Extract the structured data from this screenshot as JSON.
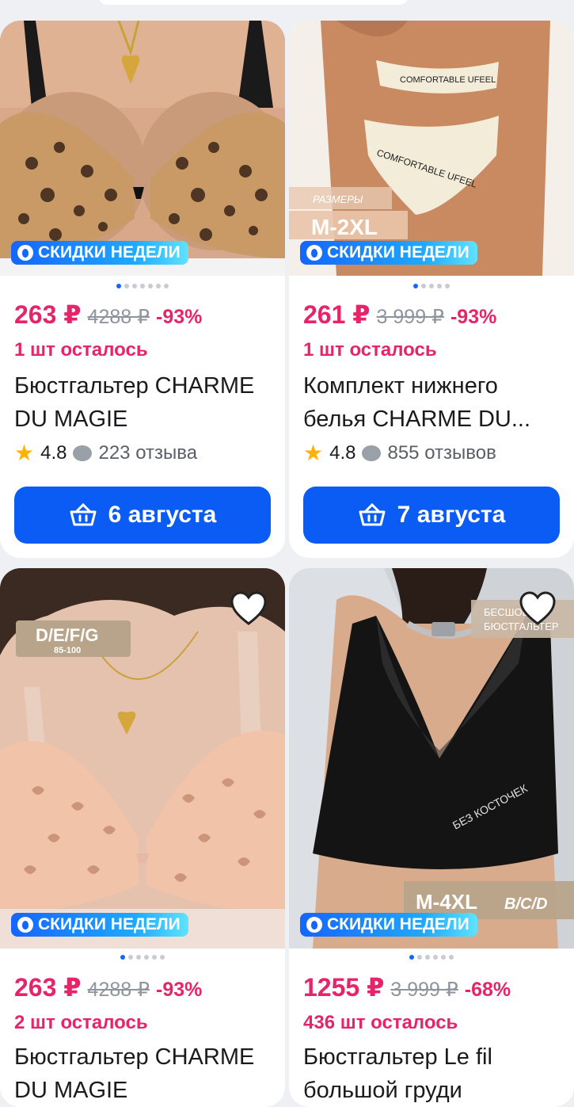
{
  "colors": {
    "accent": "#0b5cf4",
    "price": "#e6246a",
    "muted": "#8f959e"
  },
  "products": [
    {
      "promo": "СКИДКИ НЕДЕЛИ",
      "price": "263 ₽",
      "old_price": "4288 ₽",
      "discount": "-93%",
      "stock": "1 шт осталось",
      "title": "Бюстгальтер CHARME DU MAGIE",
      "rating": "4.8",
      "reviews": "223 отзыва",
      "delivery": "6 августа"
    },
    {
      "promo": "СКИДКИ НЕДЕЛИ",
      "price": "261 ₽",
      "old_price": "3 999 ₽",
      "discount": "-93%",
      "stock": "1 шт осталось",
      "title": "Комплект нижнего белья CHARME DU...",
      "rating": "4.8",
      "reviews": "855 отзывов",
      "delivery": "7 августа",
      "photo_text": {
        "band_top": "COMFORTABLE UFEEL",
        "band_bottom": "COMFORTABLE UFEEL",
        "size_caption": "РАЗМЕРЫ",
        "size_range": "M-2XL"
      }
    },
    {
      "promo": "СКИДКИ НЕДЕЛИ",
      "price": "263 ₽",
      "old_price": "4288 ₽",
      "discount": "-93%",
      "stock": "2 шт осталось",
      "title": "Бюстгальтер CHARME DU MAGIE",
      "photo_text": {
        "cup_sizes": "D/E/F/G",
        "band_sizes": "85-100"
      }
    },
    {
      "promo": "СКИДКИ НЕДЕЛИ",
      "price": "1255 ₽",
      "old_price": "3 999 ₽",
      "discount": "-68%",
      "stock": "436 шт осталось",
      "title": "Бюстгальтер Le fil большой груди",
      "photo_text": {
        "tag_line1": "БЕСШОВ",
        "tag_line2": "БЮСТГАЛЬТЕР",
        "bra_text": "БЕЗ КОСТОЧЕК",
        "size_range": "M-4XL",
        "cups": "B/C/D"
      }
    }
  ]
}
